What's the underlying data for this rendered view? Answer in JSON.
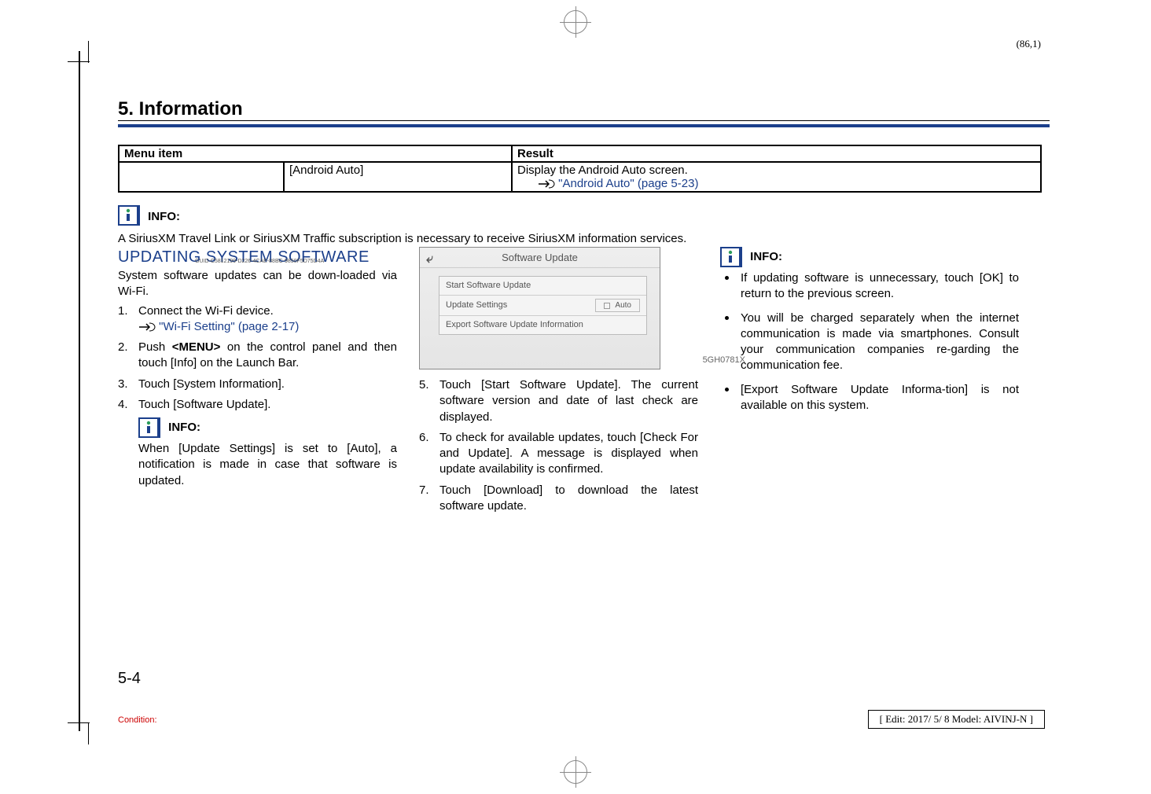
{
  "page_coord": "(86,1)",
  "section_title": "5. Information",
  "table": {
    "headers": [
      "Menu item",
      "Result"
    ],
    "row_label": "[Android Auto]",
    "result_line1": "Display the Android Auto screen.",
    "result_link": "\"Android Auto\" (page 5-23)"
  },
  "siriusxm_note": {
    "info_label": "INFO:",
    "text": "A SiriusXM Travel Link or SiriusXM Traffic subscription is necessary to receive SiriusXM information services."
  },
  "col1": {
    "heading": "UPDATING SYSTEM SOFTWARE",
    "guid": "GUID-C5812199-D226-4CAE-88BC-9850F5D75D4A",
    "intro": "System software updates can be down-loaded via Wi-Fi.",
    "step1": "Connect the Wi-Fi device.",
    "step1_link": "\"Wi-Fi Setting\" (page 2-17)",
    "step2": "Push <MENU> on the control panel and then touch [Info] on the Launch Bar.",
    "step2_pre": "Push ",
    "step2_b": "<MENU>",
    "step2_post": " on the control panel and then touch [Info] on the Launch Bar.",
    "step3": "Touch [System Information].",
    "step4": "Touch [Software Update].",
    "info_label": "INFO:",
    "info_text": "When [Update Settings] is set to [Auto], a notification is made in case that software is updated."
  },
  "col2": {
    "ss_title": "Software Update",
    "ss_row1": "Start Software Update",
    "ss_row2": "Update Settings",
    "ss_auto": "Auto",
    "ss_row3": "Export Software Update Information",
    "img_id": "5GH0781X",
    "step5": "Touch [Start Software Update]. The current software version and date of last check are displayed.",
    "step6": "To check for available updates, touch [Check For and Update]. A message is displayed when update availability is confirmed.",
    "step7": "Touch [Download] to download the latest software update."
  },
  "col3": {
    "info_label": "INFO:",
    "b1": "If updating software is unnecessary, touch [OK] to return to the previous screen.",
    "b2": "You will be charged separately when the internet communication is made via smartphones. Consult your communication companies re-garding the communication fee.",
    "b3": "[Export Software Update Informa-tion] is not available on this system."
  },
  "page_number": "5-4",
  "condition": "Condition:",
  "edit_box": "[ Edit: 2017/ 5/ 8   Model: AIVINJ-N ]"
}
